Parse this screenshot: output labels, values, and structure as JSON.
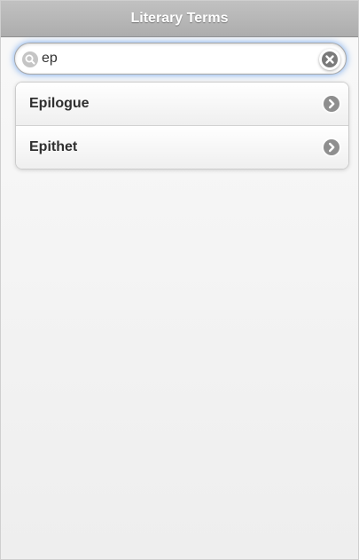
{
  "header": {
    "title": "Literary Terms"
  },
  "search": {
    "value": "ep",
    "placeholder": ""
  },
  "results": [
    {
      "label": "Epilogue"
    },
    {
      "label": "Epithet"
    }
  ],
  "icons": {
    "search": "search-icon",
    "clear": "close-icon",
    "item_arrow": "chevron-right-icon"
  },
  "colors": {
    "header_bg": "#b4b4b4",
    "focus_glow": "#6ea4ee",
    "icon_gray": "#8e8e8e"
  }
}
